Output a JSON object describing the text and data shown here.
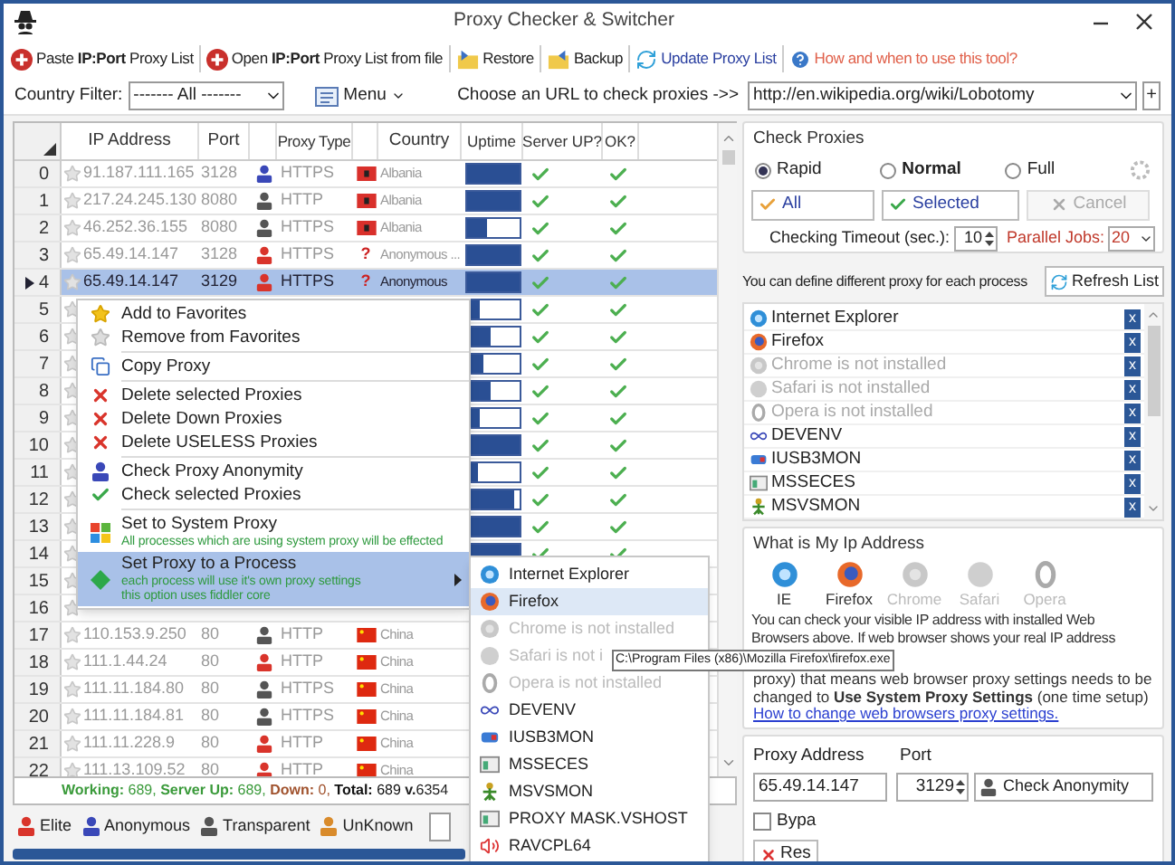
{
  "window": {
    "title": "Proxy Checker & Switcher"
  },
  "toolbar": [
    {
      "kind": "add",
      "label": "Paste **IP:Port** Proxy List"
    },
    {
      "kind": "add",
      "label": "Open **IP:Port** Proxy List from file"
    },
    {
      "kind": "restore",
      "label": "Restore"
    },
    {
      "kind": "backup",
      "label": "Backup"
    },
    {
      "kind": "update",
      "label": "Update Proxy List"
    },
    {
      "kind": "help",
      "label": "How and when to use this tool?"
    }
  ],
  "filter": {
    "label": "Country Filter:",
    "value": "------- All -------",
    "menu": "Menu",
    "url_label": "Choose an URL to check proxies ->>",
    "url": "http://en.wikipedia.org/wiki/Lobotomy",
    "add": "+"
  },
  "table": {
    "columns": [
      "IP Address",
      "Port",
      "Proxy Type",
      "Country",
      "Uptime",
      "Server UP?",
      "OK?"
    ],
    "rows": [
      {
        "n": "0",
        "ip": "91.187.111.165",
        "port": "3128",
        "type": {
          "kind": "anonymous",
          "label": "HTTPS"
        },
        "country": {
          "kind": "albania",
          "label": "Albania"
        },
        "level": 1,
        "server_up": true,
        "ok": true,
        "selected": false
      },
      {
        "n": "1",
        "ip": "217.24.245.130",
        "port": "8080",
        "type": {
          "kind": "transparent",
          "label": "HTTP"
        },
        "country": {
          "kind": "albania",
          "label": "Albania"
        },
        "level": 1,
        "server_up": true,
        "ok": true,
        "selected": false
      },
      {
        "n": "2",
        "ip": "46.252.36.155",
        "port": "8080",
        "type": {
          "kind": "transparent",
          "label": "HTTPS"
        },
        "country": {
          "kind": "albania",
          "label": "Albania"
        },
        "level": 0.4,
        "server_up": true,
        "ok": true,
        "selected": false
      },
      {
        "n": "3",
        "ip": "65.49.14.147",
        "port": "3128",
        "type": {
          "kind": "elite",
          "label": "HTTPS"
        },
        "country": {
          "kind": "unknown",
          "flag": "?",
          "label": "Anonymous ..."
        },
        "level": 1,
        "server_up": true,
        "ok": true,
        "selected": false
      },
      {
        "n": "4",
        "ip": "65.49.14.147",
        "port": "3129",
        "type": {
          "kind": "elite",
          "label": "HTTPS"
        },
        "country": {
          "kind": "unknown",
          "flag": "?",
          "label": "Anonymous"
        },
        "level": 1,
        "server_up": true,
        "ok": true,
        "selected": true
      },
      {
        "n": "5",
        "level": 0.25,
        "server_up": true,
        "ok": true,
        "selected": false
      },
      {
        "n": "6",
        "level": 0.45,
        "server_up": true,
        "ok": true,
        "selected": false
      },
      {
        "n": "7",
        "level": 0.33,
        "server_up": true,
        "ok": true,
        "selected": false
      },
      {
        "n": "8",
        "level": 0.45,
        "server_up": true,
        "ok": true,
        "selected": false
      },
      {
        "n": "9",
        "level": 0.25,
        "server_up": true,
        "ok": true,
        "selected": false
      },
      {
        "n": "10",
        "level": 1,
        "server_up": true,
        "ok": true,
        "selected": false
      },
      {
        "n": "11",
        "level": 0.22,
        "server_up": true,
        "ok": true,
        "selected": false
      },
      {
        "n": "12",
        "level": 0.92,
        "server_up": true,
        "ok": true,
        "selected": false
      },
      {
        "n": "13",
        "level": 1,
        "server_up": true,
        "ok": true,
        "selected": false
      },
      {
        "n": "14",
        "level": 1,
        "server_up": true,
        "ok": true,
        "selected": false
      },
      {
        "n": "15",
        "selected": false
      },
      {
        "n": "16",
        "selected": false
      },
      {
        "n": "17",
        "ip": "110.153.9.250",
        "port": "80",
        "type": {
          "kind": "transparent",
          "label": "HTTP"
        },
        "country": {
          "kind": "china",
          "label": "China"
        },
        "selected": false
      },
      {
        "n": "18",
        "ip": "111.1.44.24",
        "port": "80",
        "type": {
          "kind": "elite",
          "label": "HTTP"
        },
        "country": {
          "kind": "china",
          "label": "China"
        },
        "selected": false
      },
      {
        "n": "19",
        "ip": "111.11.184.80",
        "port": "80",
        "type": {
          "kind": "transparent",
          "label": "HTTPS"
        },
        "country": {
          "kind": "china",
          "label": "China"
        },
        "selected": false
      },
      {
        "n": "20",
        "ip": "111.11.184.81",
        "port": "80",
        "type": {
          "kind": "transparent",
          "label": "HTTPS"
        },
        "country": {
          "kind": "china",
          "label": "China"
        },
        "selected": false
      },
      {
        "n": "21",
        "ip": "111.11.228.9",
        "port": "80",
        "type": {
          "kind": "elite",
          "label": "HTTP"
        },
        "country": {
          "kind": "china",
          "label": "China"
        },
        "selected": false
      },
      {
        "n": "22",
        "ip": "111.13.109.52",
        "port": "80",
        "type": {
          "kind": "elite",
          "label": "HTTP"
        },
        "country": {
          "kind": "china",
          "label": "China"
        },
        "selected": false
      }
    ]
  },
  "status": {
    "parts": [
      {
        "kind": "up",
        "label": "Working:",
        "value": "689,"
      },
      {
        "kind": "up",
        "label": "Server Up:",
        "value": "689,"
      },
      {
        "kind": "down",
        "label": "Down:",
        "value": "0,"
      },
      {
        "kind": "total",
        "label": "Total:",
        "value": "689"
      }
    ],
    "version": "**v.**6354"
  },
  "legend": [
    {
      "kind": "elite",
      "label": "Elite"
    },
    {
      "kind": "anonymous",
      "label": "Anonymous"
    },
    {
      "kind": "transparent",
      "label": "Transparent"
    },
    {
      "kind": "unknown",
      "label": "UnKnown"
    }
  ],
  "context_menu": [
    {
      "kind": "star",
      "label": "Add to Favorites",
      "selected": false
    },
    {
      "kind": "star-off",
      "label": "Remove from Favorites",
      "selected": false
    },
    {
      "kind": "separator"
    },
    {
      "kind": "copy",
      "label": "Copy Proxy",
      "selected": false
    },
    {
      "kind": "separator"
    },
    {
      "kind": "delete",
      "label": "Delete selected Proxies",
      "selected": false
    },
    {
      "kind": "delete",
      "label": "Delete Down Proxies",
      "selected": false
    },
    {
      "kind": "delete",
      "label": "Delete USELESS Proxies",
      "selected": false
    },
    {
      "kind": "separator"
    },
    {
      "kind": "user",
      "label": "Check Proxy Anonymity",
      "selected": false
    },
    {
      "kind": "check",
      "label": "Check selected Proxies",
      "selected": false
    },
    {
      "kind": "separator"
    },
    {
      "kind": "windows",
      "label": "Set to System Proxy",
      "notes": [
        "All processes which are using system proxy will be effected"
      ],
      "selected": false
    },
    {
      "kind": "process",
      "label": "Set Proxy to a Process",
      "notes": [
        "each process will use it's own proxy settings",
        "this option uses fiddler core"
      ],
      "submenu": true,
      "selected": true
    }
  ],
  "submenu": [
    {
      "kind": "ie",
      "label": "Internet Explorer",
      "disabled": false,
      "selected": false
    },
    {
      "kind": "firefox",
      "label": "Firefox",
      "disabled": false,
      "selected": true
    },
    {
      "kind": "chrome",
      "label": "Chrome is not installed",
      "disabled": true,
      "selected": false
    },
    {
      "kind": "safari",
      "label": "Safari is not i",
      "disabled": true,
      "selected": false
    },
    {
      "kind": "opera",
      "label": "Opera is not installed",
      "disabled": true,
      "selected": false
    },
    {
      "kind": "devenv",
      "label": "DEVENV",
      "disabled": false,
      "selected": false
    },
    {
      "kind": "usb",
      "label": "IUSB3MON",
      "disabled": false,
      "selected": false
    },
    {
      "kind": "window",
      "label": "MSSECES",
      "disabled": false,
      "selected": false
    },
    {
      "kind": "figure",
      "label": "MSVSMON",
      "disabled": false,
      "selected": false
    },
    {
      "kind": "window",
      "label": "PROXY MASK.VSHOST",
      "disabled": false,
      "selected": false
    },
    {
      "kind": "speaker",
      "label": "RAVCPL64",
      "disabled": false,
      "selected": false
    }
  ],
  "tooltip": {
    "text": "C:\\Program Files (x86)\\Mozilla Firefox\\firefox.exe"
  },
  "check_proxies": {
    "title": "Check Proxies",
    "modes": [
      {
        "label": "Rapid",
        "emphasized": false,
        "selected": true
      },
      {
        "label": "Normal",
        "emphasized": true,
        "selected": false
      },
      {
        "label": "Full",
        "emphasized": false,
        "selected": false
      }
    ],
    "buttons": [
      {
        "kind": "all",
        "label": "All",
        "disabled": false
      },
      {
        "kind": "selected",
        "label": "Selected",
        "disabled": false
      },
      {
        "kind": "cancel",
        "label": "Cancel",
        "disabled": true
      }
    ],
    "timeout_label": "Checking Timeout (sec.):",
    "timeout": "10",
    "jobs_label": "Parallel Jobs:",
    "jobs": "20"
  },
  "processes": {
    "hint": "You can define different proxy for each process",
    "refresh": "Refresh List",
    "items": [
      {
        "kind": "ie",
        "label": "Internet Explorer",
        "disabled": false,
        "remove": "x"
      },
      {
        "kind": "firefox",
        "label": "Firefox",
        "disabled": false,
        "remove": "x"
      },
      {
        "kind": "chrome",
        "label": "Chrome is not installed",
        "disabled": true,
        "remove": "x"
      },
      {
        "kind": "safari",
        "label": "Safari is not installed",
        "disabled": true,
        "remove": "x"
      },
      {
        "kind": "opera",
        "label": "Opera is not installed",
        "disabled": true,
        "remove": "x"
      },
      {
        "kind": "devenv",
        "label": "DEVENV",
        "disabled": false,
        "remove": "x"
      },
      {
        "kind": "usb",
        "label": "IUSB3MON",
        "disabled": false,
        "remove": "x"
      },
      {
        "kind": "window",
        "label": "MSSECES",
        "disabled": false,
        "remove": "x"
      },
      {
        "kind": "figure",
        "label": "MSVSMON",
        "disabled": false,
        "remove": "x"
      }
    ]
  },
  "my_ip": {
    "title": "What is My Ip Address",
    "browsers": [
      {
        "kind": "ie",
        "label": "IE",
        "disabled": false
      },
      {
        "kind": "firefox",
        "label": "Firefox",
        "disabled": false
      },
      {
        "kind": "chrome",
        "label": "Chrome",
        "disabled": true
      },
      {
        "kind": "safari",
        "label": "Safari",
        "disabled": true
      },
      {
        "kind": "opera",
        "label": "Opera",
        "disabled": true
      }
    ],
    "text": "You can check your visible IP address with installed Web Browsers above. If web browser shows your real IP address",
    "text_2": "proxy) that means web browser proxy settings needs to be changed to **Use System Proxy Settings** (one time setup)",
    "link": "How to change web browsers proxy settings."
  },
  "proxy_form": {
    "address_label": "Proxy Address",
    "port_label": "Port",
    "address": "65.49.14.147",
    "port": "3129",
    "check": "Check Anonymity",
    "bypass": {
      "label": "Bypa",
      "checked": false
    },
    "reset": "Res"
  }
}
